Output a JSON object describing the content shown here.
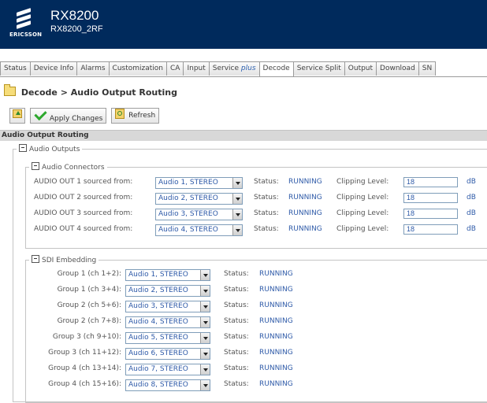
{
  "header": {
    "brand": "ERICSSON",
    "title": "RX8200",
    "subtitle": "RX8200_2RF",
    "bg_color": "#002a5c"
  },
  "tabs": [
    {
      "label": "Status"
    },
    {
      "label": "Device Info"
    },
    {
      "label": "Alarms"
    },
    {
      "label": "Customization"
    },
    {
      "label": "CA"
    },
    {
      "label": "Input"
    },
    {
      "label": "Service ",
      "emph": "plus"
    },
    {
      "label": "Decode",
      "active": true
    },
    {
      "label": "Service Split"
    },
    {
      "label": "Output"
    },
    {
      "label": "Download"
    },
    {
      "label": "SN"
    }
  ],
  "breadcrumb": {
    "icon": "folder-icon",
    "text": "Decode > Audio Output Routing"
  },
  "toolbar": {
    "up_icon": "folder-up-icon",
    "apply_label": "Apply Changes",
    "refresh_label": "Refresh"
  },
  "section_title": "Audio Output Routing",
  "audio_outputs": {
    "legend": "Audio Outputs",
    "connectors": {
      "legend": "Audio Connectors",
      "status_label": "Status:",
      "clipping_label": "Clipping Level:",
      "unit": "dB",
      "rows": [
        {
          "label": "AUDIO OUT 1 sourced from:",
          "source": "Audio 1, STEREO",
          "status": "RUNNING",
          "clip": "18"
        },
        {
          "label": "AUDIO OUT 2 sourced from:",
          "source": "Audio 2, STEREO",
          "status": "RUNNING",
          "clip": "18"
        },
        {
          "label": "AUDIO OUT 3 sourced from:",
          "source": "Audio 3, STEREO",
          "status": "RUNNING",
          "clip": "18"
        },
        {
          "label": "AUDIO OUT 4 sourced from:",
          "source": "Audio 4, STEREO",
          "status": "RUNNING",
          "clip": "18"
        }
      ]
    },
    "sdi": {
      "legend": "SDI Embedding",
      "status_label": "Status:",
      "rows": [
        {
          "label": "Group 1 (ch 1+2):",
          "source": "Audio 1, STEREO",
          "status": "RUNNING"
        },
        {
          "label": "Group 1 (ch 3+4):",
          "source": "Audio 2, STEREO",
          "status": "RUNNING"
        },
        {
          "label": "Group 2 (ch 5+6):",
          "source": "Audio 3, STEREO",
          "status": "RUNNING"
        },
        {
          "label": "Group 2 (ch 7+8):",
          "source": "Audio 4, STEREO",
          "status": "RUNNING"
        },
        {
          "label": "Group 3 (ch 9+10):",
          "source": "Audio 5, STEREO",
          "status": "RUNNING"
        },
        {
          "label": "Group 3 (ch 11+12):",
          "source": "Audio 6, STEREO",
          "status": "RUNNING"
        },
        {
          "label": "Group 4 (ch 13+14):",
          "source": "Audio 7, STEREO",
          "status": "RUNNING"
        },
        {
          "label": "Group 4 (ch 15+16):",
          "source": "Audio 8, STEREO",
          "status": "RUNNING"
        }
      ]
    }
  }
}
